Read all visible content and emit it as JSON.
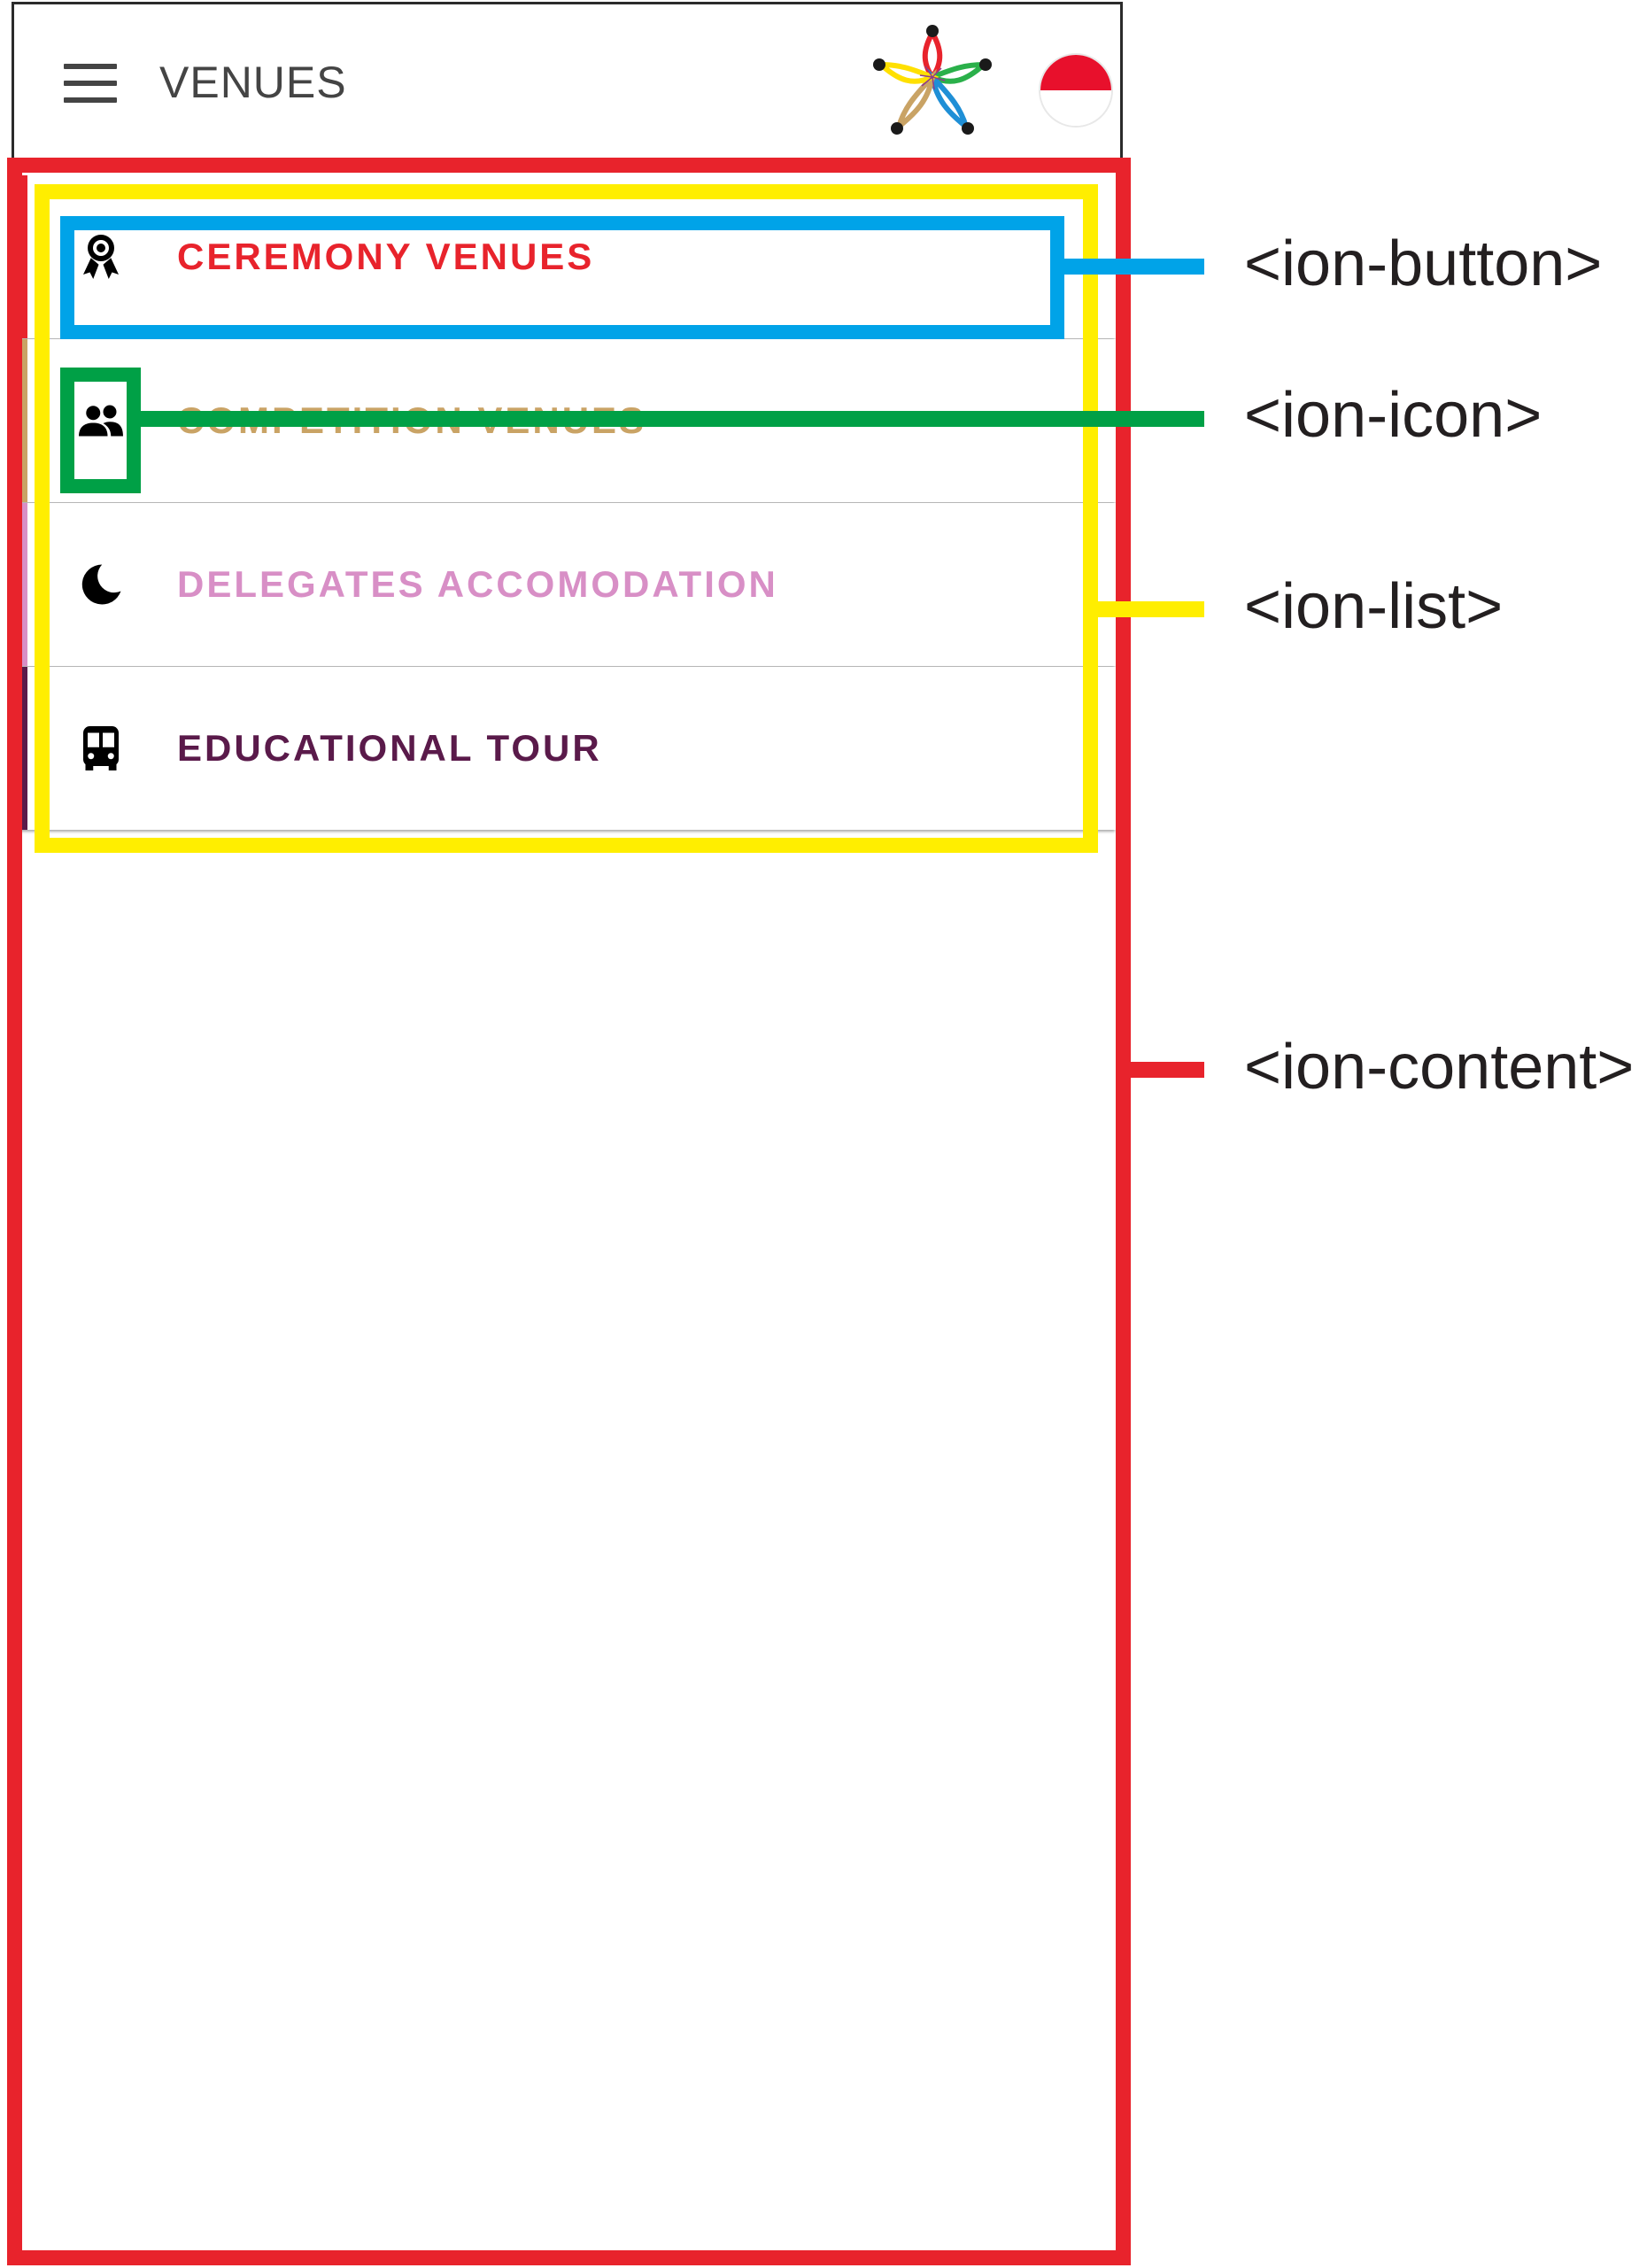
{
  "header": {
    "title": "VENUES",
    "menu_icon": "hamburger-menu-icon",
    "logo_icon": "flower-logo-icon",
    "flag_icon": "indonesia-flag-icon"
  },
  "list": {
    "items": [
      {
        "label": "CEREMONY VENUES",
        "icon": "award-ribbon-icon",
        "color": "#e8232c"
      },
      {
        "label": "COMPETITION VENUES",
        "icon": "people-icon",
        "color": "#c9a365"
      },
      {
        "label": "DELEGATES ACCOMODATION",
        "icon": "moon-icon",
        "color": "#d88fc6"
      },
      {
        "label": "EDUCATIONAL TOUR",
        "icon": "bus-icon",
        "color": "#5a1a4a"
      }
    ]
  },
  "annotations": {
    "button": {
      "label": "<ion-button>",
      "color": "#00a3e8"
    },
    "icon": {
      "label": "<ion-icon>",
      "color": "#00a046"
    },
    "list": {
      "label": "<ion-list>",
      "color": "#ffee00"
    },
    "content": {
      "label": "<ion-content>",
      "color": "#e8232c"
    }
  }
}
